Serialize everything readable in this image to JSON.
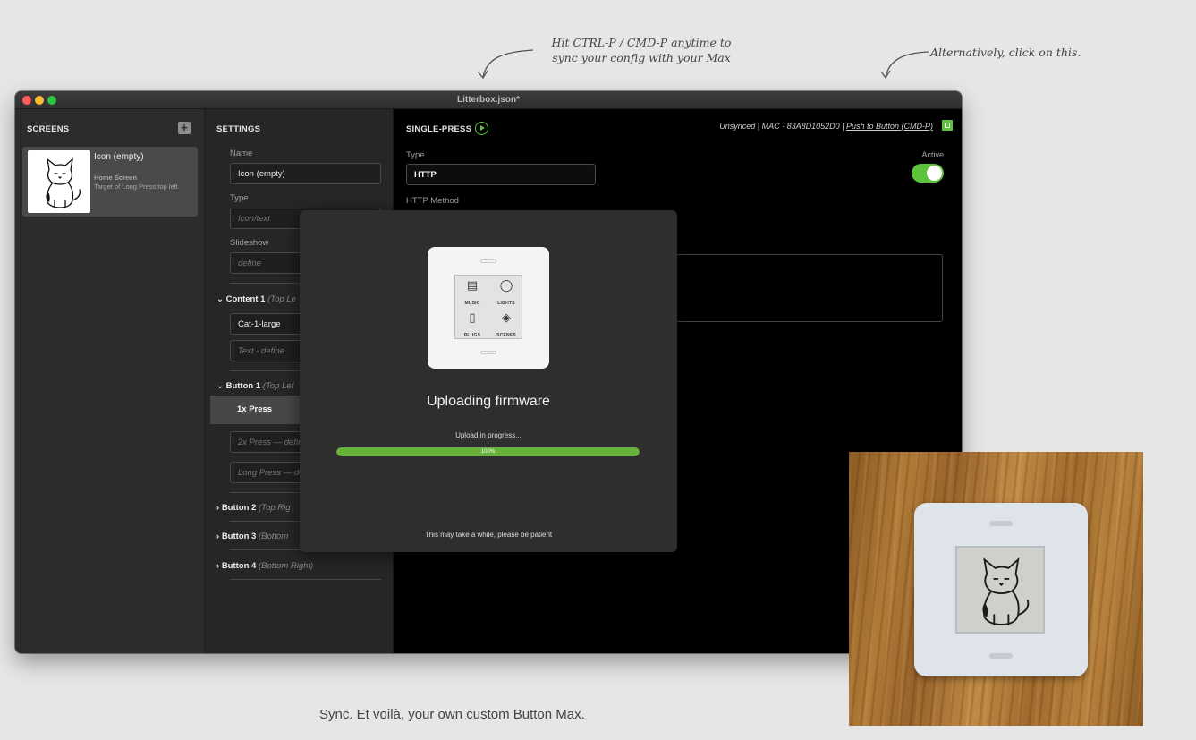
{
  "annotations": {
    "hotkey_line1": "Hit CTRL-P / CMD-P anytime to",
    "hotkey_line2": "sync your config with your Max",
    "click_hint": "Alternatively, click on this."
  },
  "window": {
    "title": "Litterbox.json*"
  },
  "screens": {
    "header": "SCREENS",
    "add_symbol": "+",
    "items": [
      {
        "name": "Icon (empty)",
        "subtitle": "Home Screen",
        "detail": "Target of Long Press top left"
      }
    ]
  },
  "settings": {
    "header": "SETTINGS",
    "name_label": "Name",
    "name_value": "Icon (empty)",
    "type_label": "Type",
    "type_placeholder": "Icon/text",
    "slideshow_label": "Slideshow",
    "slideshow_placeholder": "define",
    "content1": {
      "label": "Content 1",
      "hint": "(Top Le",
      "value": "Cat-1-large",
      "text_placeholder": "Text - define"
    },
    "button1": {
      "label": "Button 1",
      "hint": "(Top Lef",
      "press_1x": "1x Press",
      "press_2x": "2x Press — defin",
      "press_long": "Long Press — de"
    },
    "button2": {
      "label": "Button 2",
      "hint": "(Top Rig"
    },
    "button3": {
      "label": "Button 3",
      "hint": "(Bottom"
    },
    "button4": {
      "label": "Button 4",
      "hint": "(Bottom Right)"
    }
  },
  "main": {
    "header": "SINGLE-PRESS",
    "sync_status": "Unsynced | MAC · 83A8D1052D0 | ",
    "push_link": "Push to Button (CMD-P)",
    "type_label": "Type",
    "type_value": "HTTP",
    "http_method_label": "HTTP Method",
    "active_label": "Active",
    "active": true
  },
  "modal": {
    "device_labels": [
      "MUSIC",
      "LIGHTS",
      "PLUGS",
      "SCENES"
    ],
    "title": "Uploading firmware",
    "status": "Upload in progress...",
    "progress_label": "100%",
    "progress_percent": 100,
    "note": "This may take a while, please be patient"
  },
  "caption": "Sync. Et voilà, your own custom Button Max.",
  "colors": {
    "accent_green": "#5ec23a",
    "progress_green": "#67b33a"
  },
  "icons": [
    "play-icon",
    "sync-icon",
    "plus-icon",
    "chevron-down-icon",
    "chevron-right-icon"
  ]
}
